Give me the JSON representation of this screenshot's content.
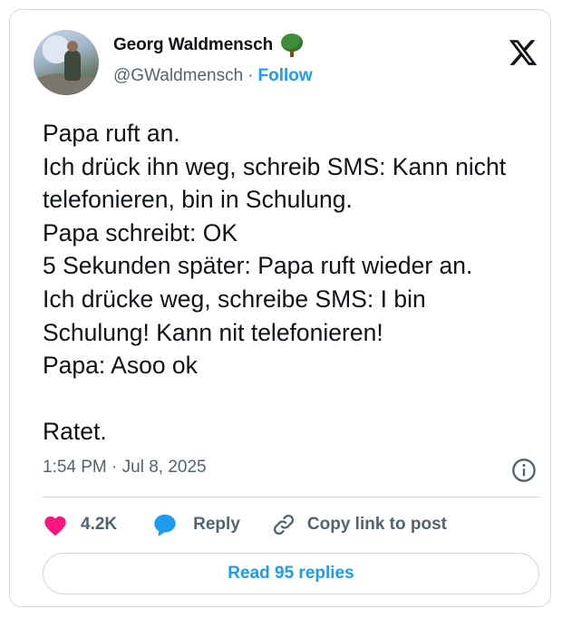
{
  "author": {
    "name": "Georg Waldmensch",
    "handle": "@GWaldmensch",
    "separator": "·",
    "follow_label": "Follow",
    "badge_icon": "deciduous-tree-emoji"
  },
  "tweet": {
    "text": "Papa ruft an.\nIch drück ihn weg, schreib SMS: Kann nicht telefonieren, bin in Schulung.\nPapa schreibt: OK\n5 Sekunden später: Papa ruft wieder an.\nIch drücke weg, schreibe SMS: I bin Schulung! Kann nit telefonieren!\nPapa: Asoo ok\n\nRatet.",
    "timestamp": "1:54 PM · Jul 8, 2025"
  },
  "actions": {
    "likes_count": "4.2K",
    "reply_label": "Reply",
    "copy_link_label": "Copy link to post",
    "read_replies_label": "Read 95 replies"
  },
  "colors": {
    "accent": "#1d9bf0",
    "like": "#f91880",
    "muted": "#536471",
    "border": "#cfd9de"
  }
}
